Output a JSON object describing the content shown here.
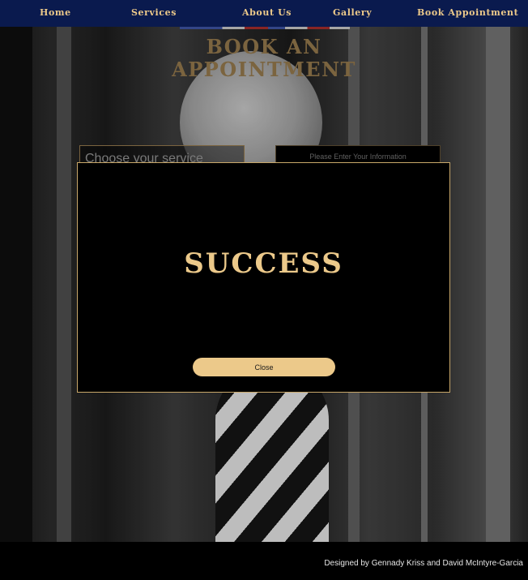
{
  "nav": {
    "items": [
      {
        "label": "Home"
      },
      {
        "label": "Services"
      },
      {
        "label": "About Us"
      },
      {
        "label": "Gallery"
      },
      {
        "label": "Book Appointment"
      }
    ]
  },
  "page": {
    "title": "BOOK AN APPOINTMENT"
  },
  "form": {
    "service_placeholder": "Choose your service",
    "info_placeholder": "Please Enter Your Information"
  },
  "modal": {
    "title": "SUCCESS",
    "close_label": "Close"
  },
  "footer": {
    "credit": "Designed by Gennady Kriss and David McIntyre-Garcia"
  },
  "colors": {
    "nav_bg": "#0a1a4e",
    "accent_gold": "#ecc98a",
    "modal_border": "#c9a86a"
  }
}
